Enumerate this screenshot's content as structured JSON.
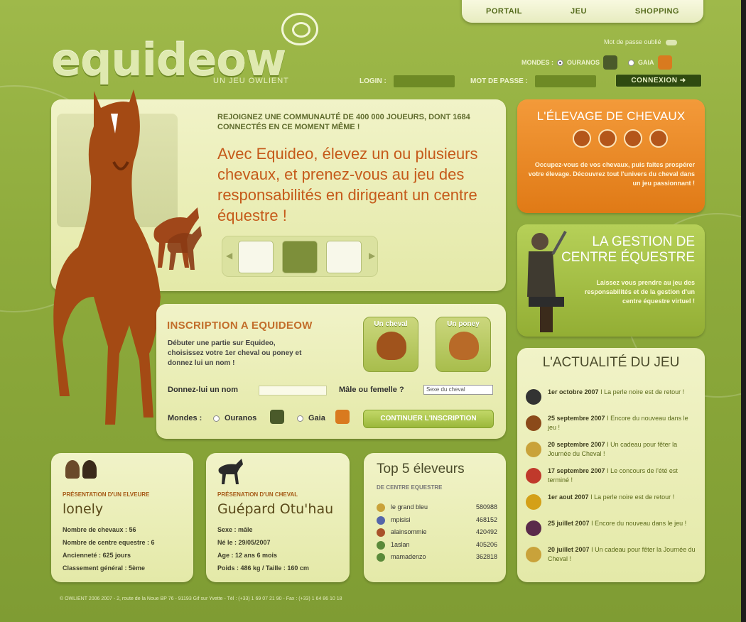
{
  "nav": {
    "portail": "PORTAIL",
    "jeu": "JEU",
    "shopping": "SHOPPING"
  },
  "logo": {
    "text": "equideow",
    "tagline": "UN JEU OWLIENT"
  },
  "login": {
    "lost_password": "Mot de passe oublié",
    "mondes_label": "MONDES :",
    "world1": "OURANOS",
    "world2": "GAIA",
    "login_label": "LOGIN :",
    "password_label": "MOT DE PASSE :",
    "connect_label": "CONNEXION"
  },
  "hero": {
    "headline": "REJOIGNEZ UNE COMMUNAUTÉ DE 400 000 JOUEURS, DONT 1684 CONNECTÉS EN CE MOMENT MÊME !",
    "pitch": "Avec Equideo, élevez un ou plusieurs chevaux, et prenez-vous au jeu des responsabilités en dirigeant un centre équestre !"
  },
  "inscription": {
    "title": "INSCRIPTION A EQUIDEOW",
    "description": "Débuter une partie sur Equideo, choisissez votre 1er cheval ou poney et donnez lui un nom !",
    "horse_label": "Un cheval",
    "pony_label": "Un poney",
    "name_label": "Donnez-lui un nom",
    "sex_label": "Mâle ou femelle ?",
    "sex_select": "Sexe du cheval",
    "worlds_label": "Mondes :",
    "world1": "Ouranos",
    "world2": "Gaia",
    "continue_label": "CONTINUER L'INSCRIPTION"
  },
  "elevage": {
    "title": "L'ÉLEVAGE DE CHEVAUX",
    "text": "Occupez-vous de vos chevaux, puis faites prospérer votre élevage. Découvrez tout l'univers du cheval dans un jeu passionnant !"
  },
  "gestion": {
    "title_line1": "LA GESTION DE",
    "title_line2": "CENTRE ÉQUESTRE",
    "text": "Laissez vous prendre au jeu des responsabilités et de la gestion d'un centre équestre virtuel !"
  },
  "actualite": {
    "title": "L'ACTUALITÉ DU JEU",
    "items": [
      {
        "date": "1er octobre 2007",
        "text": "La perle noire est de retour !",
        "icon": "black-pearl-icon",
        "color": "#333333"
      },
      {
        "date": "25 septembre 2007",
        "text": "Encore du nouveau dans le jeu !",
        "icon": "saddle-icon",
        "color": "#8b4a1a"
      },
      {
        "date": "20 septembre 2007",
        "text": "Un cadeau pour fêter la Journée du Cheval !",
        "icon": "horseshoe-icon",
        "color": "#c9a23a"
      },
      {
        "date": "17 septembre 2007",
        "text": "Le concours de l'été est terminé !",
        "icon": "potion-icon",
        "color": "#c0392b"
      },
      {
        "date": "1er aout 2007",
        "text": "La perle noire est de retour !",
        "icon": "gold-pearl-icon",
        "color": "#d4a017"
      },
      {
        "date": "25 juillet 2007",
        "text": "Encore du nouveau dans le jeu !",
        "icon": "grapes-icon",
        "color": "#5a2a4a"
      },
      {
        "date": "20 juillet 2007",
        "text": "Un cadeau pour fêter la Journée du Cheval !",
        "icon": "horseshoe-icon",
        "color": "#c9a23a"
      }
    ]
  },
  "eleveur": {
    "caption": "PRÉSENTATION D'UN ELVEURE",
    "name": "lonely",
    "horses": "Nombre de chevaux : 56",
    "centers": "Nombre de centre equestre : 6",
    "seniority": "Ancienneté : 625 jours",
    "ranking": "Classement général : 5ème"
  },
  "cheval": {
    "caption": "PRÉSENATION D'UN CHEVAL",
    "name": "Guépard Otu'hau",
    "sex": "Sexe : mâle",
    "born": "Né le : 29/05/2007",
    "age": "Age : 12 ans 6 mois",
    "weight": "Poids : 486 kg / Taille : 160 cm"
  },
  "top5": {
    "title": "Top 5 éleveurs",
    "subtitle": "DE CENTRE EQUESTRE",
    "ranks": [
      {
        "name": "le grand bleu",
        "score": "580988",
        "color": "#c9a23a"
      },
      {
        "name": "mpisisi",
        "score": "468152",
        "color": "#5566aa"
      },
      {
        "name": "alainsommie",
        "score": "420492",
        "color": "#a8522a"
      },
      {
        "name": "1aslan",
        "score": "405206",
        "color": "#5a8a3a"
      },
      {
        "name": "mamadenzo",
        "score": "362818",
        "color": "#5a8a3a"
      }
    ]
  },
  "footer": "© OWLIENT 2006 2007 - 2, route de la Noue BP 76 - 91193 Gif sur Yvette - Tél : (+33) 1 69 07 21 90 - Fax : (+33) 1 64 86 10 18",
  "colors": {
    "page_green": "#9fb94a",
    "orange": "#e07a16",
    "panel": "#f1f3c8"
  }
}
